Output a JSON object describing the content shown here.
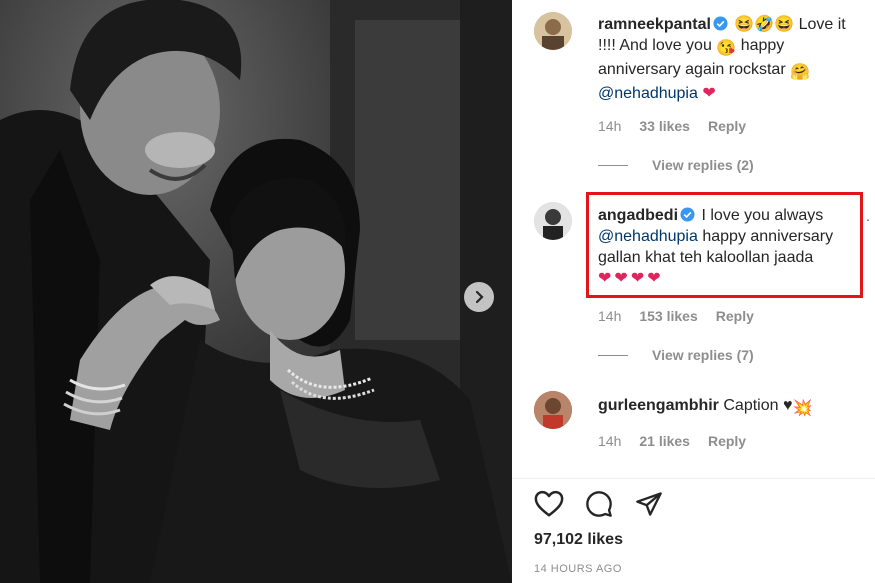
{
  "photo": {
    "alt": "Black and white photo of a smiling couple",
    "next_icon": "chevron-right-icon"
  },
  "comments": [
    {
      "username": "ramneekpantal",
      "verified": true,
      "emojis_inline": "😆🤣😆",
      "text_lines": [
        "Love it !!!! And love you",
        "happy anniversary again rockstar"
      ],
      "mention": "@nehadhupia",
      "time": "14h",
      "likes": "33 likes",
      "reply": "Reply",
      "view_replies": "View replies (2)"
    },
    {
      "username": "angadbedi",
      "verified": true,
      "text_lines": [
        "I love you always",
        "happy anniversary",
        "gallan khat teh kaloollan jaada"
      ],
      "mention": "@nehadhupia",
      "hearts": "❤❤❤❤",
      "time": "14h",
      "likes": "153 likes",
      "reply": "Reply",
      "view_replies": "View replies (7)"
    },
    {
      "username": "gurleengambhir",
      "verified": false,
      "text_lines": [
        "Caption"
      ],
      "time": "14h",
      "likes": "21 likes",
      "reply": "Reply"
    }
  ],
  "post": {
    "likes_total": "97,102 likes",
    "time_ago": "14 HOURS AGO"
  },
  "colors": {
    "highlight_border": "#e4141b",
    "mention": "#00376b",
    "muted": "#8e8e8e",
    "verified": "#3897f0"
  }
}
